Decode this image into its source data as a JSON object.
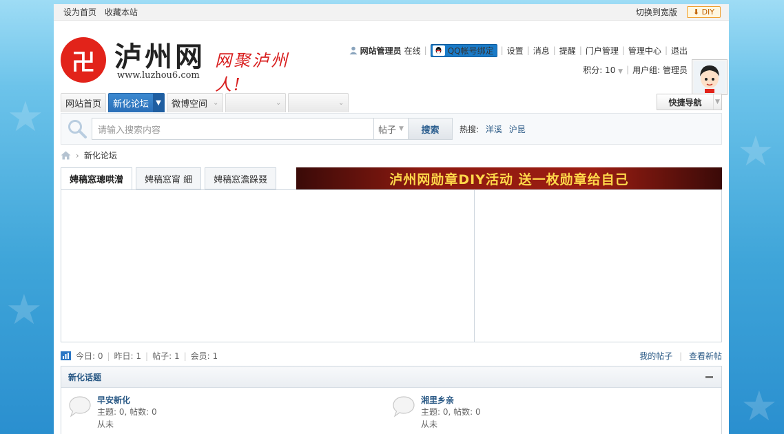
{
  "topbar": {
    "set_home": "设为首页",
    "bookmark": "收藏本站",
    "switch_wide": "切换到宽版",
    "diy": "DIY"
  },
  "logo": {
    "mark": "卍",
    "name": "泸州网",
    "url": "www.luzhou6.com",
    "slogan": "网聚泸州人!"
  },
  "user": {
    "name": "网站管理员",
    "online": "在线",
    "qq_bind": "QQ帐号绑定",
    "links": [
      "设置",
      "消息",
      "提醒",
      "门户管理",
      "管理中心",
      "退出"
    ],
    "points_label": "积分: 10",
    "group_label": "用户组: 管理员"
  },
  "nav": {
    "items": [
      "网站首页",
      "新化论坛",
      "微博空间"
    ],
    "quick_nav": "快捷导航"
  },
  "search": {
    "placeholder": "请输入搜索内容",
    "type": "帖子",
    "button": "搜索",
    "hot_label": "热搜:",
    "hot_terms": [
      "洋溪",
      "沪昆"
    ]
  },
  "breadcrumb": {
    "current": "新化论坛"
  },
  "tabs": [
    "娉稿窓璁哄潧",
    "娉稿窓甯   細",
    "娉稿窓澹跺叕"
  ],
  "banner": {
    "text": "泸州网勋章DIY活动 送一枚勋章给自己"
  },
  "stats": {
    "today": "今日: 0",
    "yesterday": "昨日: 1",
    "posts": "帖子: 1",
    "members": "会员: 1",
    "my_posts": "我的帖子",
    "new_posts": "查看新帖"
  },
  "forum": {
    "title": "新化话题",
    "boards": [
      {
        "name": "早安新化",
        "stats": "主题: 0, 帖数: 0",
        "last": "从未"
      },
      {
        "name": "湘里乡亲",
        "stats": "主题: 0, 帖数: 0",
        "last": "从未"
      }
    ]
  },
  "colors": {
    "brand_red": "#e2231a",
    "nav_blue": "#2a6fb8",
    "link_blue": "#2b5a86"
  }
}
